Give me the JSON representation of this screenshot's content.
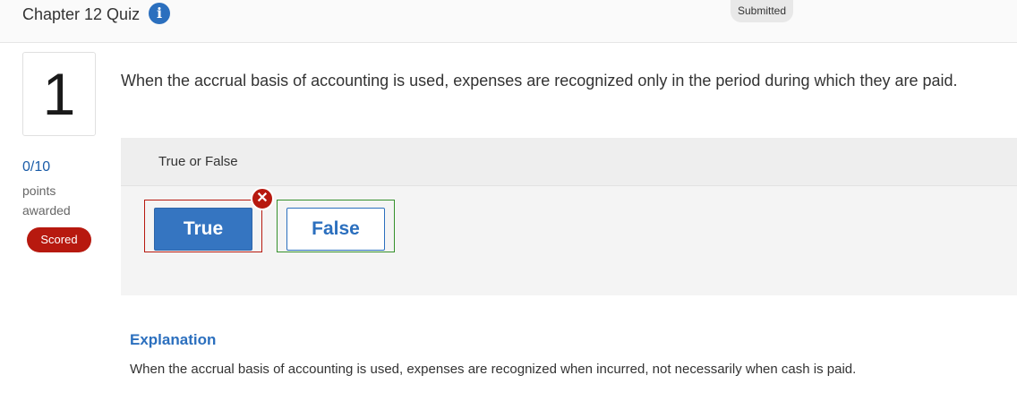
{
  "header": {
    "quiz_title": "Chapter 12 Quiz",
    "info_icon": "info-icon",
    "status_badge": "Submitted"
  },
  "question": {
    "number": "1",
    "points_value": "0/10",
    "points_label": "points awarded",
    "scored_badge": "Scored",
    "text": "When the accrual basis of accounting is used, expenses are recognized only in the period during which they are paid.",
    "type_label": "True or False",
    "choices": [
      {
        "label": "True",
        "selected": true,
        "correct": false
      },
      {
        "label": "False",
        "selected": false,
        "correct": true
      }
    ],
    "incorrect_marker_icon": "x-circle-icon"
  },
  "explanation": {
    "title": "Explanation",
    "text": "When the accrual basis of accounting is used, expenses are recognized when incurred, not necessarily when cash is paid."
  },
  "colors": {
    "accent_blue": "#2b6fbe",
    "selected_button": "#3575c1",
    "incorrect_red": "#b7190f",
    "correct_green": "#35912c"
  }
}
